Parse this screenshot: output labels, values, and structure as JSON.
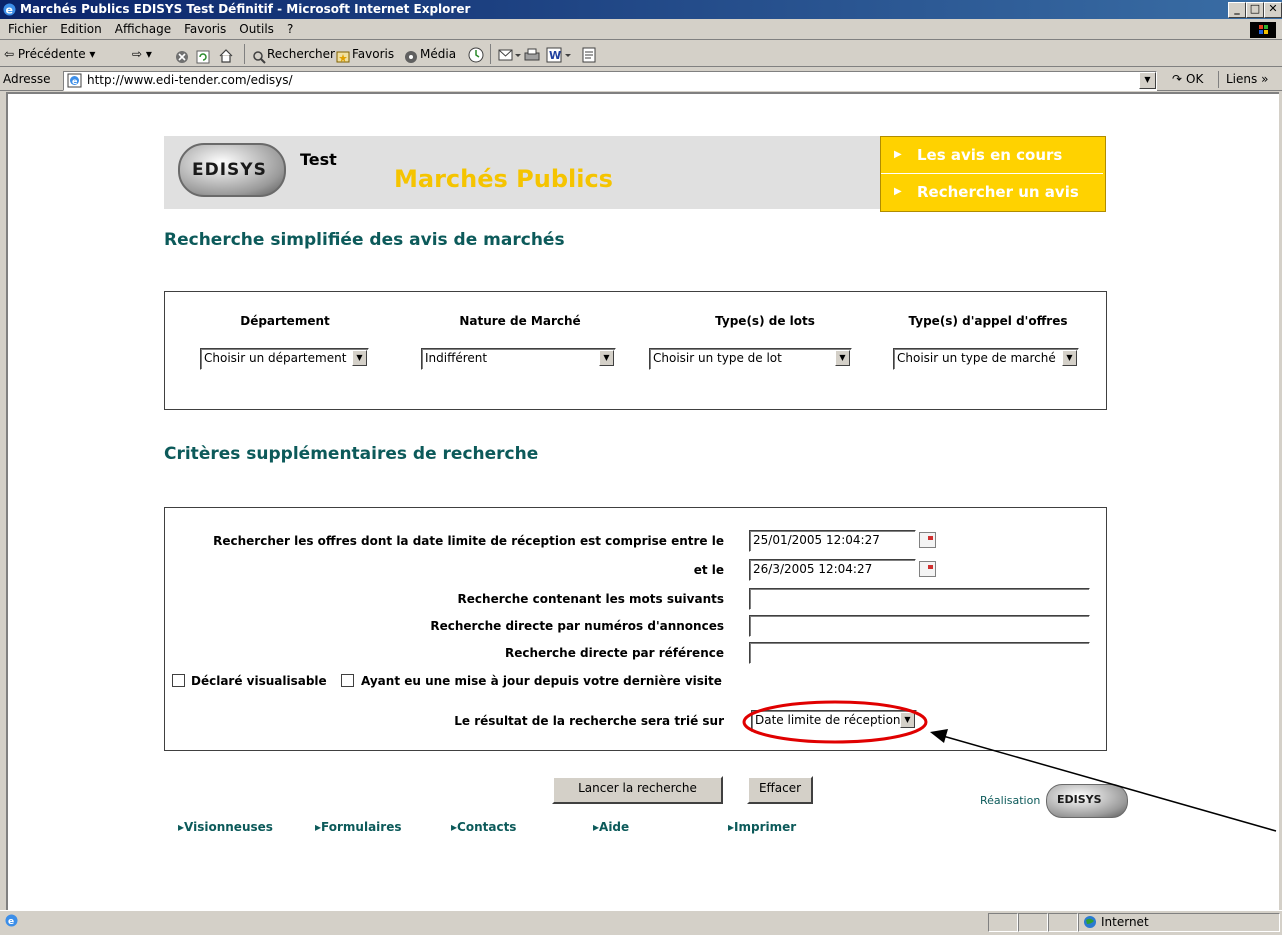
{
  "window": {
    "title": "Marchés Publics EDISYS Test Définitif - Microsoft Internet Explorer",
    "controls": {
      "minimize": "_",
      "maximize": "□",
      "close": "✕"
    }
  },
  "menu": {
    "items": [
      "Fichier",
      "Edition",
      "Affichage",
      "Favoris",
      "Outils",
      "?"
    ]
  },
  "toolbar": {
    "back": "⇦ Précédente ▾",
    "forward": "⇨ ▾",
    "search": "Rechercher",
    "favorites": "Favoris",
    "media": "Média"
  },
  "address": {
    "label": "Adresse",
    "url": "http://www.edi-tender.com/edisys/",
    "go": "OK",
    "links": "Liens »"
  },
  "banner": {
    "logo_text": "EDISYS",
    "test": "Test",
    "title": "Marchés Publics",
    "right_menu": [
      "Les avis en cours",
      "Rechercher un avis"
    ]
  },
  "simple_search": {
    "heading": "Recherche simplifiée des avis de marchés",
    "columns": [
      {
        "label": "Département",
        "value": "Choisir un département"
      },
      {
        "label": "Nature de Marché",
        "value": "Indifférent"
      },
      {
        "label": "Type(s) de lots",
        "value": "Choisir un type de lot"
      },
      {
        "label": "Type(s) d'appel d'offres",
        "value": "Choisir un type de marché"
      }
    ]
  },
  "extra_search": {
    "heading": "Critères supplémentaires de recherche",
    "date_between_label": "Rechercher les offres dont la date limite de réception est comprise entre le",
    "date_from": "25/01/2005 12:04:27",
    "and_label": "et le",
    "date_to": "26/3/2005 12:04:27",
    "keywords_label": "Recherche contenant les mots suivants",
    "keywords_value": "",
    "numbers_label": "Recherche directe par numéros d'annonces",
    "numbers_value": "",
    "reference_label": "Recherche directe par référence",
    "reference_value": "",
    "checkbox_visible": "Déclaré visualisable",
    "checkbox_updated": "Ayant eu une mise à jour depuis votre dernière visite",
    "sort_label": "Le résultat de la recherche sera trié sur",
    "sort_value": "Date limite de réception"
  },
  "buttons": {
    "search": "Lancer la recherche",
    "clear": "Effacer"
  },
  "footer": {
    "links": [
      "Visionneuses",
      "Formulaires",
      "Contacts",
      "Aide",
      "Imprimer"
    ],
    "credit": "Réalisation",
    "credit_logo": "EDISYS"
  },
  "status": {
    "zone": "Internet"
  },
  "colors": {
    "heading": "#0c5a5a",
    "banner_title": "#f5c400",
    "menu_bg": "#ffd200",
    "annotation": "#e00000"
  }
}
